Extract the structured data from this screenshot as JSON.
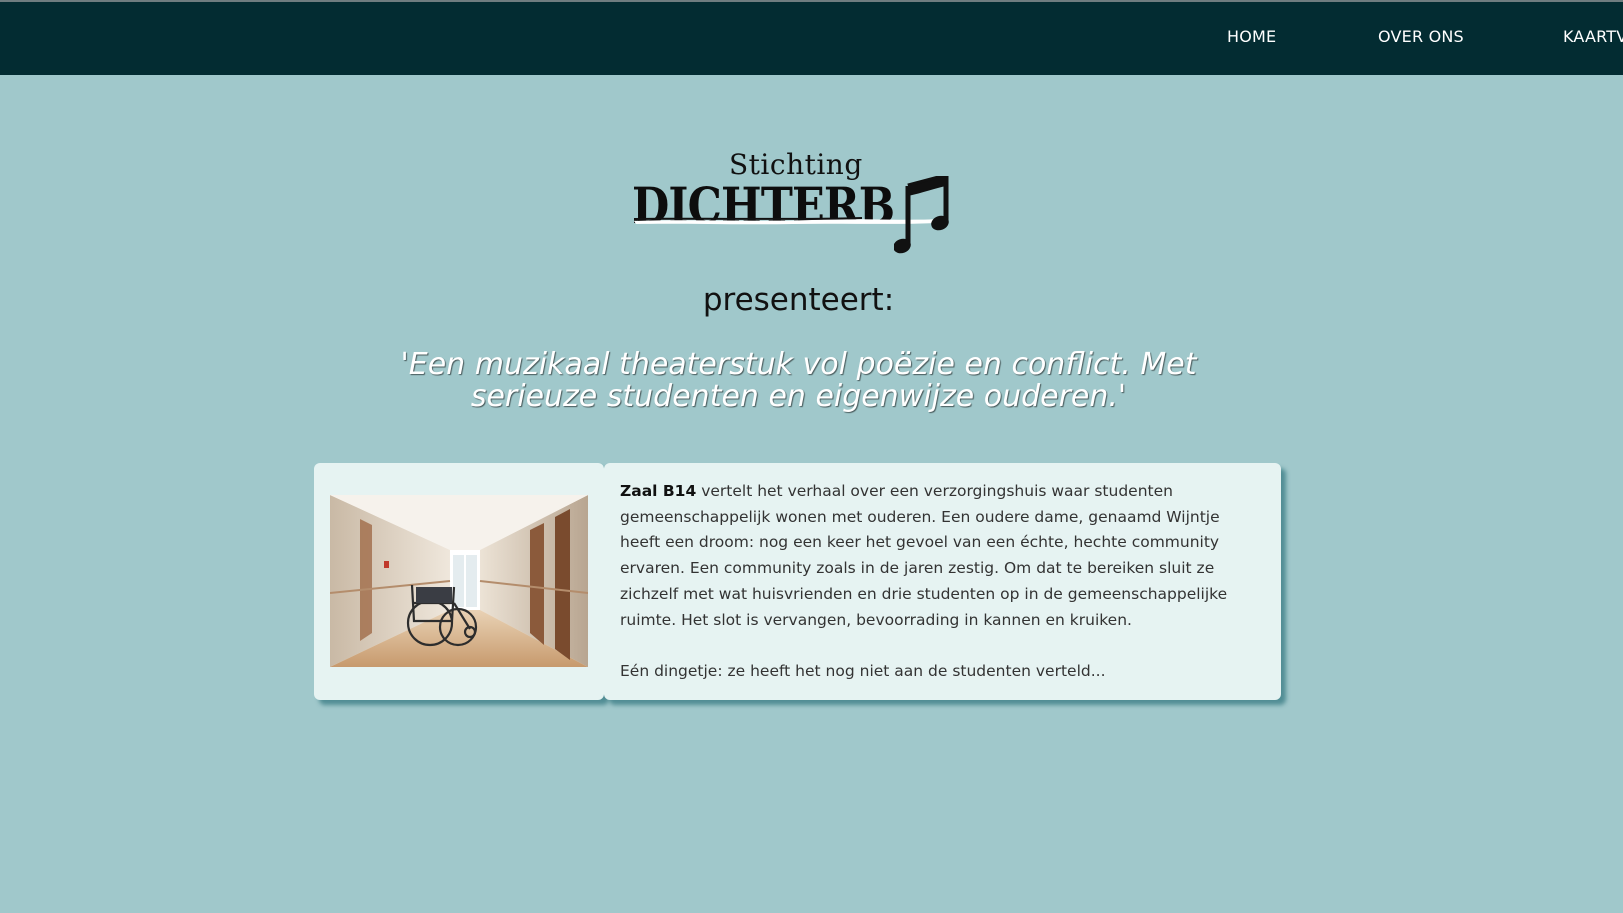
{
  "nav": {
    "items": [
      "HOME",
      "OVER ONS",
      "KAARTV"
    ]
  },
  "logo": {
    "small": "Stichting",
    "big": "DICHTERB"
  },
  "presenteert": "presenteert:",
  "tagline": "'Een muzikaal theaterstuk vol poëzie en conflict. Met serieuze studenten en eigenwijze ouderen.'",
  "card": {
    "image_alt": "Gang van een verzorgingshuis met een rolstoel",
    "bold_lead": "Zaal B14",
    "paragraph1": " vertelt het verhaal over een verzorgingshuis waar studenten gemeenschappelijk wonen met ouderen. Een oudere dame, genaamd Wijntje heeft een droom: nog een keer het gevoel van een échte, hechte community ervaren. Een community zoals in de jaren zestig. Om dat te bereiken sluit ze zichzelf met wat huisvrienden en drie studenten op in de gemeenschappelijke ruimte. Het slot is vervangen, bevoorrading in kannen en kruiken.",
    "paragraph2": "Eén dingetje: ze heeft het nog niet aan de studenten verteld..."
  },
  "colors": {
    "background": "#a0c8cb",
    "navbar": "#032c32",
    "card": "#e6f3f2"
  }
}
